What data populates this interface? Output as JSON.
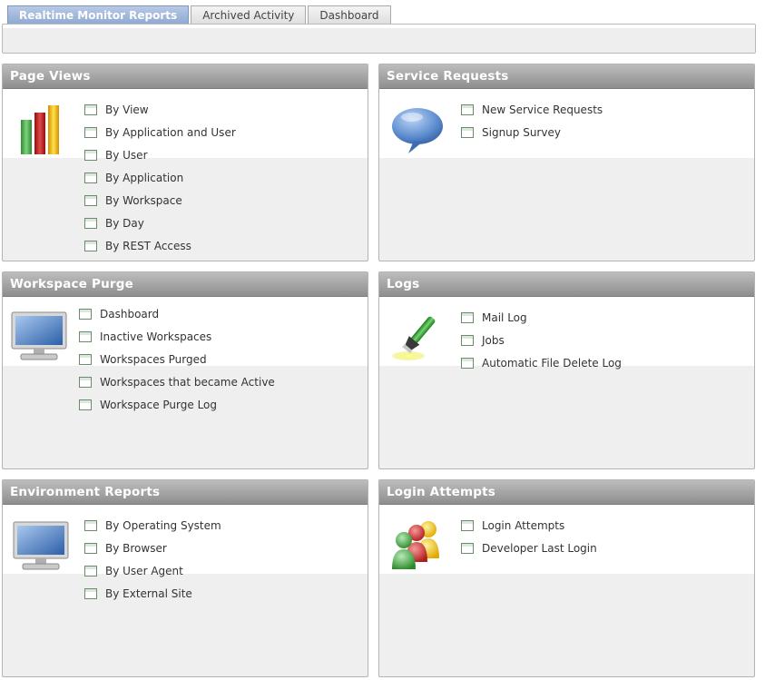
{
  "tabs": [
    {
      "label": "Realtime Monitor Reports",
      "active": true
    },
    {
      "label": "Archived Activity",
      "active": false
    },
    {
      "label": "Dashboard",
      "active": false
    }
  ],
  "panels": {
    "page_views": {
      "title": "Page Views",
      "icon": "bar-chart-icon",
      "links": [
        "By View",
        "By Application and User",
        "By User",
        "By Application",
        "By Workspace",
        "By Day",
        "By REST Access"
      ]
    },
    "service_requests": {
      "title": "Service Requests",
      "icon": "speech-bubble-icon",
      "links": [
        "New Service Requests",
        "Signup Survey"
      ]
    },
    "workspace_purge": {
      "title": "Workspace Purge",
      "icon": "monitor-icon",
      "links": [
        "Dashboard",
        "Inactive Workspaces",
        "Workspaces Purged",
        "Workspaces that became Active",
        "Workspace Purge Log"
      ]
    },
    "logs": {
      "title": "Logs",
      "icon": "flashlight-icon",
      "links": [
        "Mail Log",
        "Jobs",
        "Automatic File Delete Log"
      ]
    },
    "environment_reports": {
      "title": "Environment Reports",
      "icon": "monitor-icon",
      "links": [
        "By Operating System",
        "By Browser",
        "By User Agent",
        "By External Site"
      ]
    },
    "login_attempts": {
      "title": "Login Attempts",
      "icon": "users-icon",
      "links": [
        "Login Attempts",
        "Developer Last Login"
      ]
    }
  },
  "colors": {
    "active_tab": "#8fa9d2",
    "header": "#9a9a9a",
    "panel_bg": "#efefef"
  }
}
